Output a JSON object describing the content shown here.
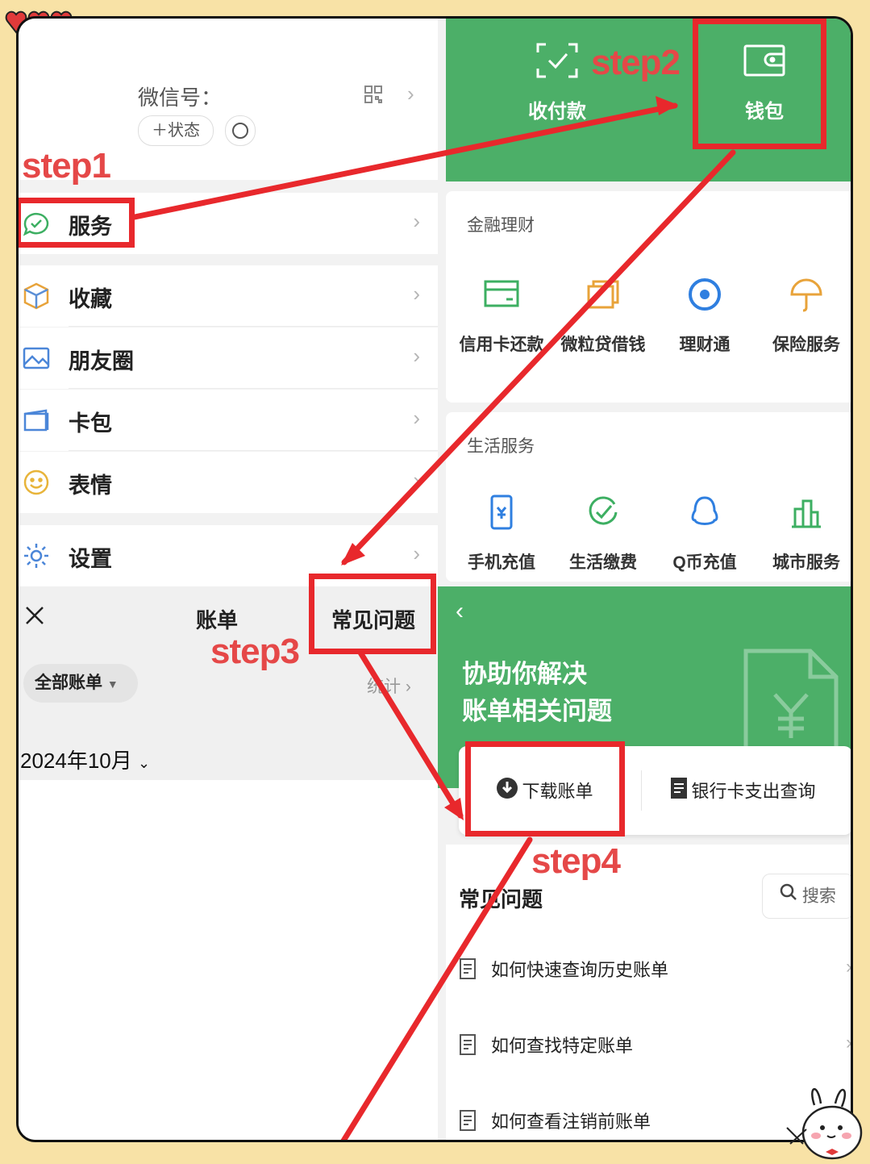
{
  "profile": {
    "wechat_id_label": "微信号：",
    "status_button": "＋状态"
  },
  "steps": {
    "step1": "step1",
    "step2": "step2",
    "step3": "step3",
    "step4": "step4"
  },
  "menu": {
    "service": "服务",
    "items": [
      {
        "label": "收藏",
        "icon": "cube-icon"
      },
      {
        "label": "朋友圈",
        "icon": "image-icon"
      },
      {
        "label": "卡包",
        "icon": "card-icon"
      },
      {
        "label": "表情",
        "icon": "smile-icon"
      }
    ],
    "settings": "设置"
  },
  "top_panel": {
    "pay_label": "收付款",
    "wallet_label": "钱包"
  },
  "finance": {
    "title": "金融理财",
    "items": [
      "信用卡还款",
      "微粒贷借钱",
      "理财通",
      "保险服务"
    ]
  },
  "life": {
    "title": "生活服务",
    "items": [
      "手机充值",
      "生活缴费",
      "Q币充值",
      "城市服务"
    ]
  },
  "bill": {
    "title": "账单",
    "faq_button": "常见问题",
    "filter": "全部账单",
    "stats": "统计",
    "month": "2024年10月"
  },
  "help": {
    "headline_line1": "协助你解决",
    "headline_line2": "账单相关问题",
    "download": "下载账单",
    "bank_query": "银行卡支出查询",
    "faq_title": "常见问题",
    "search": "搜索",
    "faq_items": [
      "如何快速查询历史账单",
      "如何查找特定账单",
      "如何查看注销前账单"
    ]
  },
  "colors": {
    "accent_green": "#4caf68",
    "highlight_red": "#e8282c",
    "step_text": "#e54848",
    "background": "#f8e2a6"
  }
}
